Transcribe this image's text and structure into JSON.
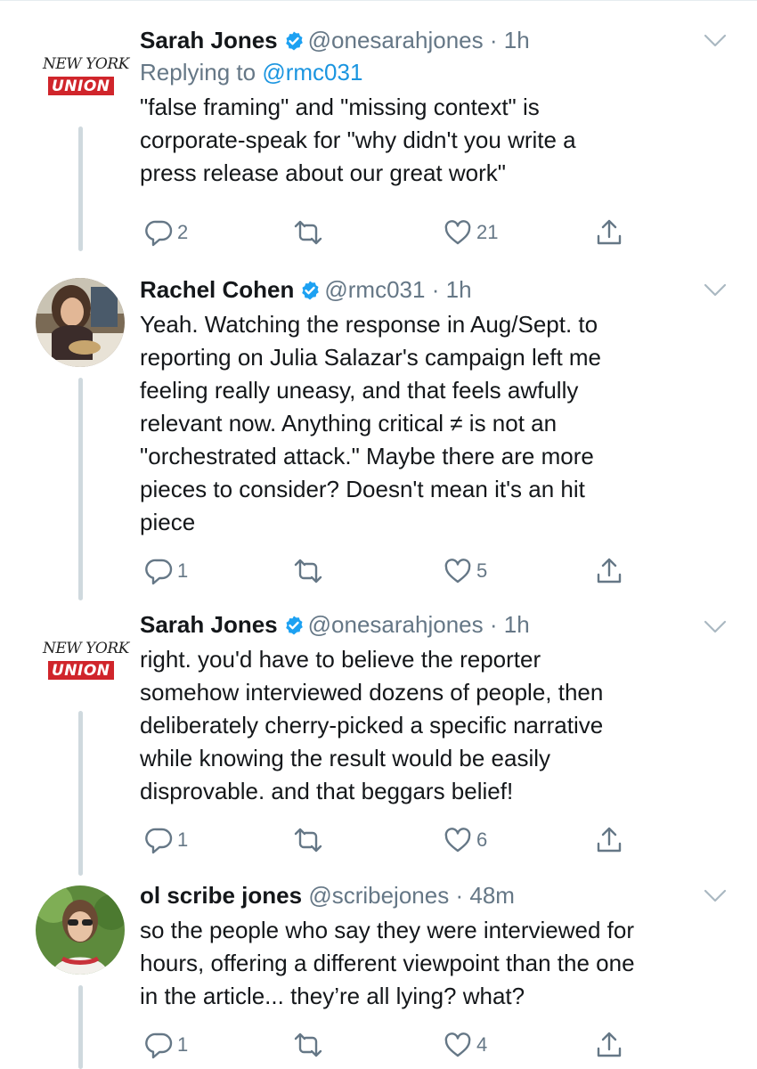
{
  "tweets": [
    {
      "name": "Sarah Jones",
      "handle": "@onesarahjones",
      "dot": "·",
      "time": "1h",
      "replying_prefix": "Replying to ",
      "replying_to": "@rmc031",
      "text": "\"false framing\" and \"missing context\" is\ncorporate-speak for \"why didn't you write a\npress release about our great work\"",
      "replies": "2",
      "retweets": "",
      "likes": "21",
      "avatar": {
        "type": "logo",
        "line1": "NEW YORK",
        "line2": "UNION"
      }
    },
    {
      "name": "Rachel Cohen",
      "handle": "@rmc031",
      "dot": "·",
      "time": "1h",
      "text": "Yeah. Watching the response in Aug/Sept. to\nreporting on Julia Salazar's campaign left me\nfeeling really uneasy, and that feels awfully\nrelevant now. Anything critical ≠ is not an\n\"orchestrated attack.\" Maybe there are more\npieces to consider? Doesn't mean it's an hit\npiece",
      "replies": "1",
      "retweets": "",
      "likes": "5",
      "avatar": {
        "type": "photo"
      }
    },
    {
      "name": "Sarah Jones",
      "handle": "@onesarahjones",
      "dot": "·",
      "time": "1h",
      "text": "right. you'd have to believe the reporter\nsomehow interviewed dozens of people, then\ndeliberately cherry-picked a specific narrative\nwhile knowing the result would be easily\ndisprovable. and that beggars belief!",
      "replies": "1",
      "retweets": "",
      "likes": "6",
      "avatar": {
        "type": "logo",
        "line1": "NEW YORK",
        "line2": "UNION"
      }
    },
    {
      "name": "ol scribe jones",
      "handle": "@scribejones",
      "dot": "·",
      "time": "48m",
      "text": "so the people who say they were interviewed for\nhours, offering a different viewpoint than the one\nin the article... they’re all lying? what?",
      "replies": "1",
      "retweets": "",
      "likes": "4",
      "avatar": {
        "type": "photo"
      }
    }
  ],
  "colors": {
    "text": "#14171a",
    "secondary": "#657786",
    "link": "#1b95e0",
    "verified": "#1da1f2",
    "thread_line": "#cfd9de",
    "union_red": "#d0252b"
  },
  "icons": [
    "verified-badge-icon",
    "chevron-down-icon",
    "reply-icon",
    "retweet-icon",
    "like-icon",
    "share-icon"
  ]
}
